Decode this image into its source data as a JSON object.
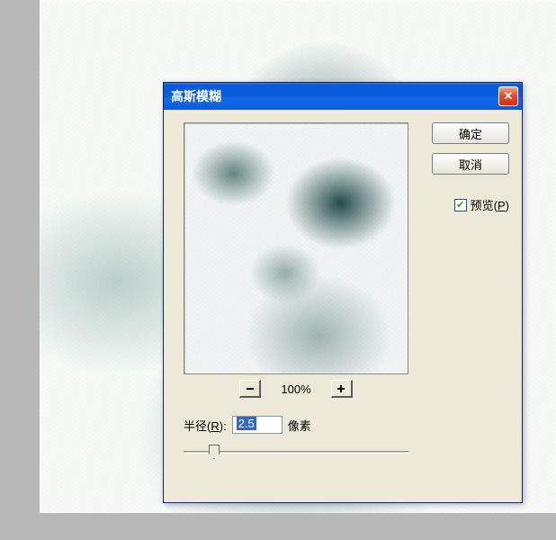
{
  "dialog": {
    "title": "高斯模糊",
    "ok_label": "确定",
    "cancel_label": "取消",
    "preview_label": "预览(",
    "preview_hotkey": "P",
    "preview_label_end": ")",
    "zoom_level": "100%",
    "radius_label_pre": "半径(",
    "radius_hotkey": "R",
    "radius_label_post": "):",
    "radius_value": "2.5",
    "radius_unit": "像素",
    "preview_checked": true
  }
}
